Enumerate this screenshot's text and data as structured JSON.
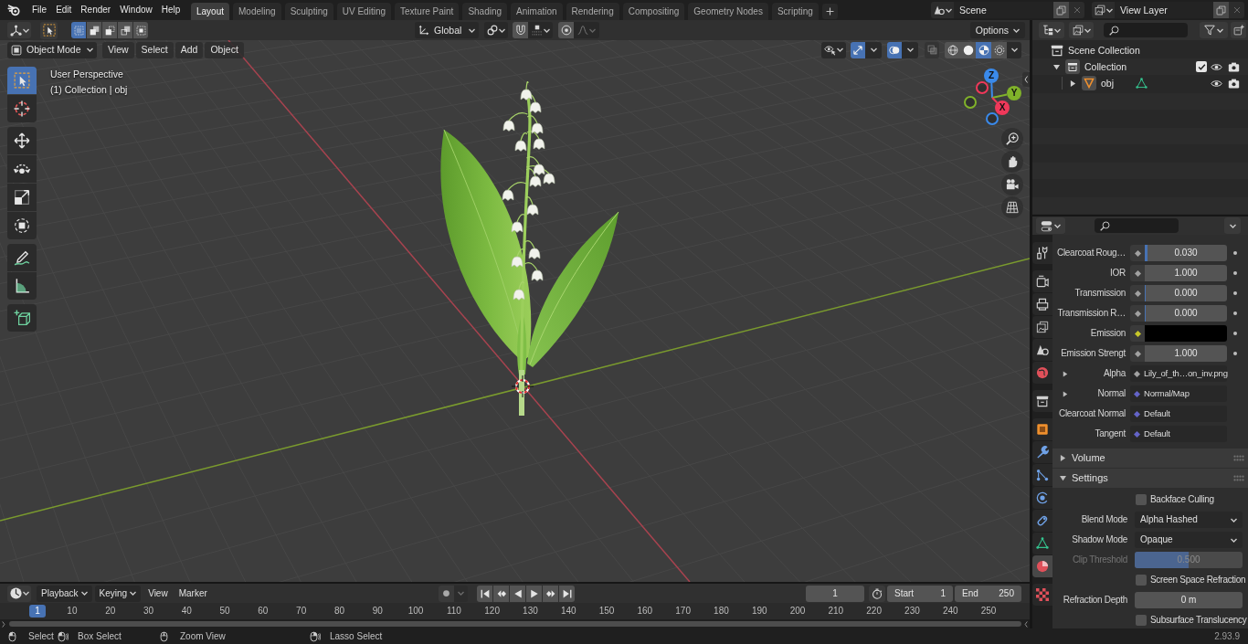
{
  "topbar": {
    "menus": [
      "File",
      "Edit",
      "Render",
      "Window",
      "Help"
    ],
    "workspaces": [
      {
        "label": "Layout",
        "selected": true
      },
      {
        "label": "Modeling",
        "selected": false
      },
      {
        "label": "Sculpting",
        "selected": false
      },
      {
        "label": "UV Editing",
        "selected": false
      },
      {
        "label": "Texture Paint",
        "selected": false
      },
      {
        "label": "Shading",
        "selected": false
      },
      {
        "label": "Animation",
        "selected": false
      },
      {
        "label": "Rendering",
        "selected": false
      },
      {
        "label": "Compositing",
        "selected": false
      },
      {
        "label": "Geometry Nodes",
        "selected": false
      },
      {
        "label": "Scripting",
        "selected": false
      }
    ],
    "scene": "Scene",
    "view_layer": "View Layer"
  },
  "viewport": {
    "tool_header": {
      "select_modes": [
        {
          "kind": "set",
          "selected": true
        },
        {
          "kind": "extend",
          "selected": false
        },
        {
          "kind": "subtract",
          "selected": false
        },
        {
          "kind": "invert",
          "selected": false
        },
        {
          "kind": "intersect",
          "selected": false
        }
      ],
      "orientation": "Global",
      "snap": {
        "on": false
      },
      "proportional": {
        "on": false
      },
      "options": "Options"
    },
    "header": {
      "mode": "Object Mode",
      "menus": [
        "View",
        "Select",
        "Add",
        "Object"
      ],
      "gizmos": {
        "on": true
      },
      "overlays": {
        "on": true
      },
      "xray": {
        "on": false
      },
      "shading": [
        {
          "kind": "wireframe",
          "selected": false
        },
        {
          "kind": "solid",
          "selected": false
        },
        {
          "kind": "material",
          "selected": true
        },
        {
          "kind": "rendered",
          "selected": false
        }
      ]
    },
    "info": [
      "User Perspective",
      "(1) Collection | obj"
    ],
    "tool_groups": [
      [
        {
          "kind": "select-box",
          "selected": true
        },
        {
          "kind": "cursor",
          "selected": false
        }
      ],
      [
        {
          "kind": "move",
          "selected": false
        },
        {
          "kind": "rotate",
          "selected": false
        },
        {
          "kind": "scale",
          "selected": false
        },
        {
          "kind": "transform",
          "selected": false
        }
      ],
      [
        {
          "kind": "annotate",
          "selected": false
        },
        {
          "kind": "measure",
          "selected": false
        }
      ],
      [
        {
          "kind": "add-cube",
          "selected": false
        }
      ]
    ],
    "gizmo": {
      "axes": [
        {
          "label": "Z",
          "color": "#3a8aeb"
        },
        {
          "label": "Y",
          "color": "#80b22a"
        },
        {
          "label": "X",
          "color": "#f0385a"
        }
      ]
    }
  },
  "outliner": {
    "tree": [
      {
        "label": "Scene Collection",
        "kind": "collection",
        "active": false,
        "children": [
          {
            "label": "Collection",
            "kind": "collection",
            "active": true,
            "expanded": true,
            "checked": true,
            "visible": true,
            "renderable": true,
            "children": [
              {
                "label": "obj",
                "kind": "object",
                "active": true,
                "expanded": false,
                "visible": true,
                "renderable": true
              }
            ]
          }
        ]
      }
    ]
  },
  "properties": {
    "tab_groups": [
      [
        {
          "kind": "tool",
          "selected": false
        }
      ],
      [
        {
          "kind": "render",
          "selected": false
        },
        {
          "kind": "output",
          "selected": false
        },
        {
          "kind": "view-layer",
          "selected": false
        },
        {
          "kind": "scene",
          "selected": false
        },
        {
          "kind": "world",
          "selected": false
        }
      ],
      [
        {
          "kind": "collection",
          "selected": false
        }
      ],
      [
        {
          "kind": "object",
          "selected": false
        },
        {
          "kind": "modifiers",
          "selected": false
        },
        {
          "kind": "particles",
          "selected": false
        },
        {
          "kind": "physics",
          "selected": false
        },
        {
          "kind": "constraints",
          "selected": false
        },
        {
          "kind": "data",
          "selected": false
        },
        {
          "kind": "material",
          "selected": true
        }
      ],
      [
        {
          "kind": "texture",
          "selected": false
        }
      ]
    ],
    "rows": [
      {
        "kind": "slider",
        "label": "Clearcoat Roug…",
        "value": "0.030",
        "level": 0.03,
        "color": "#a1a1a1"
      },
      {
        "kind": "number",
        "label": "IOR",
        "value": "1.000",
        "color": "#a1a1a1"
      },
      {
        "kind": "slider",
        "label": "Transmission",
        "value": "0.000",
        "level": 0,
        "color": "#a1a1a1"
      },
      {
        "kind": "slider",
        "label": "Transmission R…",
        "value": "0.000",
        "level": 0,
        "color": "#a1a1a1"
      },
      {
        "kind": "swatch",
        "label": "Emission",
        "swatch": {
          "color": "#000000"
        },
        "color": "#c7c729"
      },
      {
        "kind": "number",
        "label": "Emission Strengt",
        "value": "1.000",
        "color": "#a1a1a1"
      },
      {
        "kind": "link",
        "label": "Alpha",
        "value": "Lily_of_th…on_inv.png",
        "expanded": false,
        "color": "#a1a1a1"
      },
      {
        "kind": "link",
        "label": "Normal",
        "value": "Normal/Map",
        "expanded": false,
        "color": "#6363c7"
      },
      {
        "kind": "link",
        "label": "Clearcoat Normal",
        "value": "Default",
        "color": "#6363c7"
      },
      {
        "kind": "link",
        "label": "Tangent",
        "value": "Default",
        "color": "#6363c7"
      }
    ],
    "panels": [
      {
        "label": "Volume",
        "expanded": false
      },
      {
        "label": "Settings",
        "expanded": true,
        "rows": [
          {
            "kind": "checkbox",
            "label": "Backface Culling",
            "checked": false,
            "disabled": false
          },
          {
            "kind": "dropdown",
            "label": "Blend Mode",
            "value": "Alpha Hashed",
            "disabled": false
          },
          {
            "kind": "dropdown",
            "label": "Shadow Mode",
            "value": "Opaque",
            "disabled": false
          },
          {
            "kind": "slider",
            "label": "Clip Threshold",
            "value": "0.500",
            "level": 0.5,
            "disabled": true
          },
          {
            "kind": "checkbox",
            "label": "Screen Space Refraction",
            "checked": false,
            "disabled": false
          },
          {
            "kind": "number",
            "label": "Refraction Depth",
            "value": "0 m",
            "disabled": false
          },
          {
            "kind": "checkbox",
            "label": "Subsurface Translucency",
            "checked": false,
            "disabled": false
          }
        ]
      }
    ]
  },
  "timeline": {
    "menus": [
      {
        "label": "Playback",
        "kind": "dropdown"
      },
      {
        "label": "Keying",
        "kind": "dropdown"
      },
      {
        "label": "View",
        "kind": "menu"
      },
      {
        "label": "Marker",
        "kind": "menu"
      }
    ],
    "auto_keying": {
      "on": false
    },
    "current_frame": "1",
    "start": {
      "label": "Start",
      "value": "1"
    },
    "end": {
      "label": "End",
      "value": "250"
    },
    "ruler": {
      "playhead": "1",
      "labels": [
        "10",
        "20",
        "30",
        "40",
        "50",
        "60",
        "70",
        "80",
        "90",
        "100",
        "110",
        "120",
        "130",
        "140",
        "150",
        "160",
        "170",
        "180",
        "190",
        "200",
        "210",
        "220",
        "230",
        "240",
        "250"
      ]
    }
  },
  "status_bar": {
    "items": [
      {
        "kind": "left-click",
        "label": "Select"
      },
      {
        "kind": "left-drag",
        "label": "Box Select"
      },
      {
        "kind": "middle",
        "label": "Zoom View"
      },
      {
        "kind": "right-drag",
        "label": "Lasso Select"
      }
    ],
    "version": "2.93.9"
  }
}
